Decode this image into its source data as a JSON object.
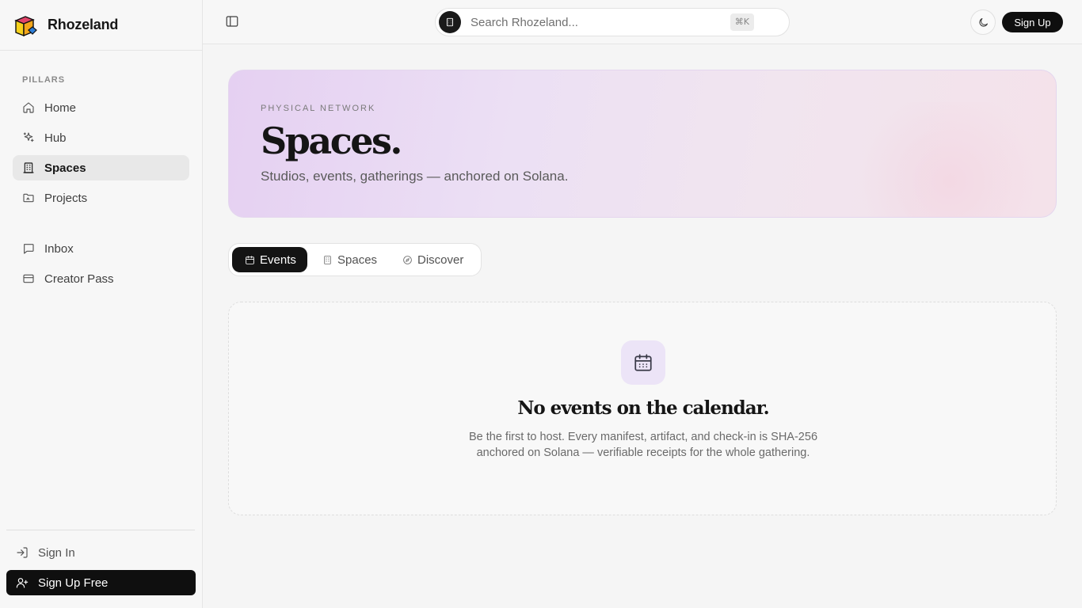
{
  "brand": {
    "name": "Rhozeland"
  },
  "sidebar": {
    "section_label": "PILLARS",
    "items": [
      {
        "label": "Home",
        "icon": "home-icon"
      },
      {
        "label": "Hub",
        "icon": "sparkles-icon"
      },
      {
        "label": "Spaces",
        "icon": "building-icon",
        "active": true
      },
      {
        "label": "Projects",
        "icon": "folder-icon"
      },
      {
        "label": "Inbox",
        "icon": "message-icon"
      },
      {
        "label": "Creator Pass",
        "icon": "card-icon"
      }
    ],
    "sign_in_label": "Sign In",
    "sign_up_free_label": "Sign Up Free"
  },
  "header": {
    "search_placeholder": "Search Rhozeland...",
    "search_shortcut": "⌘K",
    "sign_up_label": "Sign Up"
  },
  "hero": {
    "eyebrow": "PHYSICAL NETWORK",
    "title": "Spaces.",
    "subtitle": "Studios, events, gatherings — anchored on Solana."
  },
  "tabs": [
    {
      "label": "Events",
      "icon": "calendar-icon",
      "active": true
    },
    {
      "label": "Spaces",
      "icon": "building-icon"
    },
    {
      "label": "Discover",
      "icon": "compass-icon"
    }
  ],
  "empty_state": {
    "title": "No events on the calendar.",
    "description": "Be the first to host. Every manifest, artifact, and check-in is SHA-256 anchored on Solana — verifiable receipts for the whole gathering."
  },
  "colors": {
    "accent_dark": "#0f0f0f",
    "hero_gradient_start": "#e5d0f2",
    "hero_gradient_end": "#f4e2ea"
  }
}
